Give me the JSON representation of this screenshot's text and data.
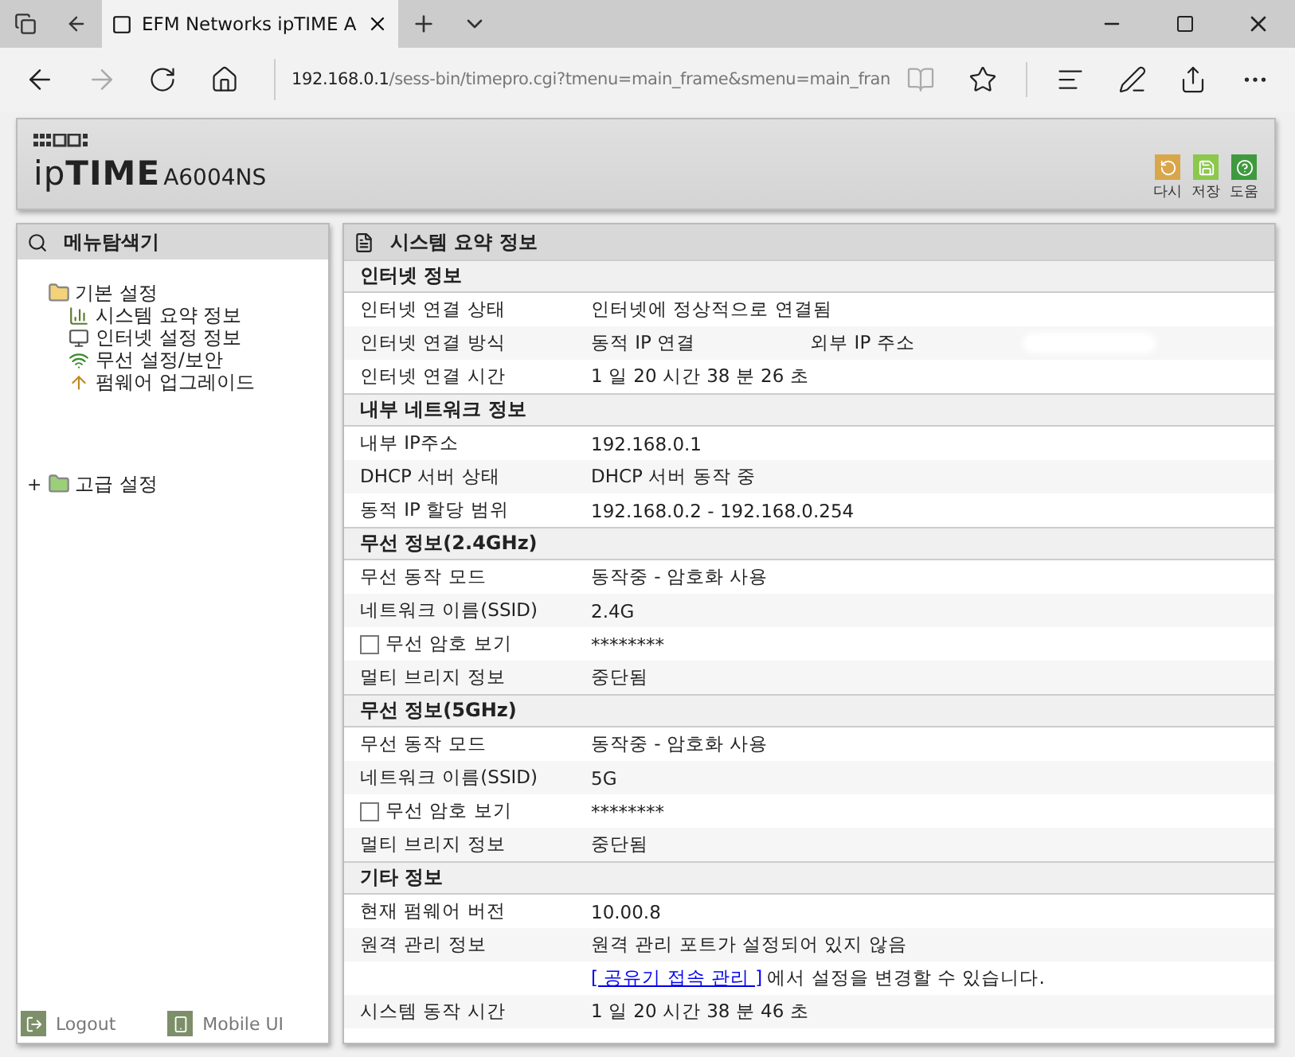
{
  "browser": {
    "tabs": [
      {
        "title": "EFM Networks ipTIME A",
        "selected": true
      }
    ],
    "address": {
      "host": "192.168.0.1",
      "path": "/sess-bin/timepro.cgi?tmenu=main_frame&smenu=main_fran"
    }
  },
  "header": {
    "logo": "ip**TIME**",
    "model": "A6004NS",
    "buttons": [
      {
        "kind": "refresh",
        "label": "다시",
        "color": "#d9a64a"
      },
      {
        "kind": "save",
        "label": "저장",
        "color": "#8cc84b"
      },
      {
        "kind": "help",
        "label": "도움",
        "color": "#3f9a3f"
      }
    ]
  },
  "sidebar": {
    "title": "메뉴탐색기",
    "tree": [
      {
        "label": "기본 설정",
        "expanded": true,
        "children": [
          {
            "label": "시스템 요약 정보",
            "kind": "chart"
          },
          {
            "label": "인터넷 설정 정보",
            "kind": "monitor"
          },
          {
            "label": "무선 설정/보안",
            "kind": "wireless"
          },
          {
            "label": "펌웨어 업그레이드",
            "kind": "upgrade"
          }
        ]
      },
      {
        "label": "고급 설정",
        "expanded": false,
        "toggle": "+"
      }
    ],
    "footer": [
      {
        "kind": "logout",
        "label": "Logout"
      },
      {
        "kind": "mobile",
        "label": "Mobile UI"
      }
    ]
  },
  "main": {
    "title": "시스템 요약 정보",
    "sections": [
      {
        "title": "인터넷 정보",
        "rows": [
          {
            "label": "인터넷 연결 상태",
            "value": "인터넷에 정상적으로 연결됨"
          },
          {
            "label": "인터넷 연결 방식",
            "value": "동적 IP 연결",
            "extra_label": "외부 IP 주소",
            "redacted": true
          },
          {
            "label": "인터넷 연결 시간",
            "value": "1 일 20 시간 38 분 26 초"
          }
        ]
      },
      {
        "title": "내부 네트워크 정보",
        "rows": [
          {
            "label": "내부 IP주소",
            "value": "192.168.0.1"
          },
          {
            "label": "DHCP 서버 상태",
            "value": "DHCP 서버 동작 중"
          },
          {
            "label": "동적 IP 할당 범위",
            "value": "192.168.0.2 -  192.168.0.254"
          }
        ]
      },
      {
        "title": "무선 정보(2.4GHz)",
        "rows": [
          {
            "label": "무선 동작 모드",
            "value": "동작중 - 암호화 사용"
          },
          {
            "label": "네트워크 이름(SSID)",
            "value": "2.4G"
          },
          {
            "label": "무선 암호 보기",
            "value": "********",
            "checked": false
          },
          {
            "label": "멀티 브리지 정보",
            "value": "중단됨"
          }
        ]
      },
      {
        "title": "무선 정보(5GHz)",
        "rows": [
          {
            "label": "무선 동작 모드",
            "value": "동작중 - 암호화 사용"
          },
          {
            "label": "네트워크 이름(SSID)",
            "value": "5G"
          },
          {
            "label": "무선 암호 보기",
            "value": "********",
            "checked": false
          },
          {
            "label": "멀티 브리지 정보",
            "value": "중단됨"
          }
        ]
      },
      {
        "title": "기타 정보",
        "rows": [
          {
            "label": "현재 펌웨어 버전",
            "value": "10.00.8"
          },
          {
            "label": "원격 관리 정보",
            "value": "원격 관리 포트가 설정되어 있지 않음"
          },
          {
            "link": "[ 공유기 접속 관리 ]",
            "value": "에서 설정을 변경할 수 있습니다."
          },
          {
            "label": "시스템 동작 시간",
            "value": "1 일 20 시간 38 분 46 초"
          }
        ]
      }
    ]
  }
}
